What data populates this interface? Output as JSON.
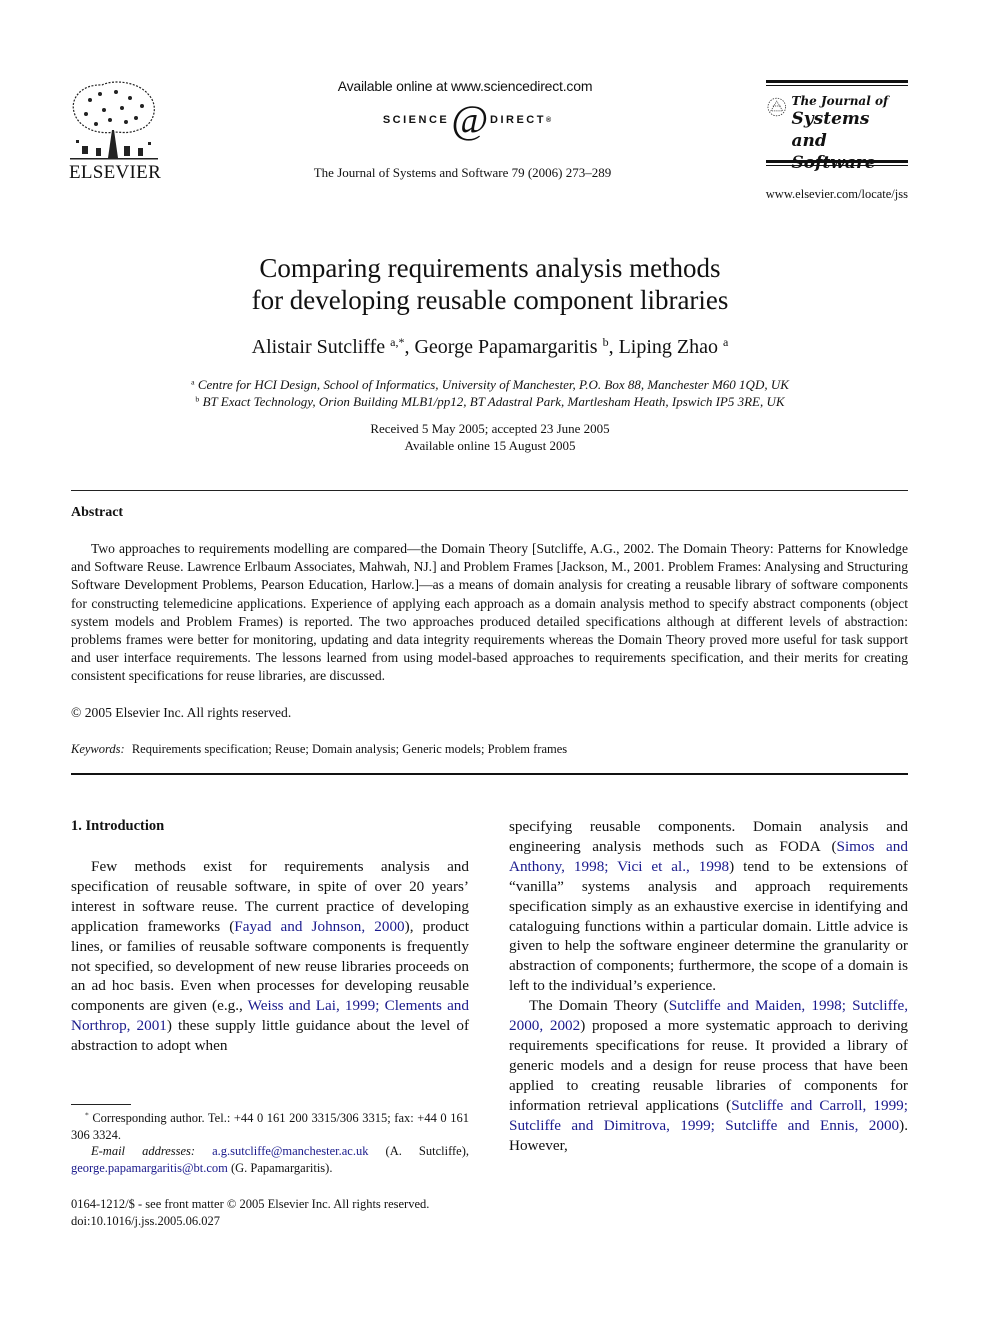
{
  "header": {
    "publisher_name": "ELSEVIER",
    "sciencedirect_available": "Available online at www.sciencedirect.com",
    "sciencedirect_left": "SCIENCE",
    "sciencedirect_at": "d",
    "sciencedirect_right": "DIRECT",
    "sciencedirect_reg": "®",
    "journal_citation": "The Journal of Systems and Software 79 (2006) 273–289",
    "journal_logo_line1": "The Journal of",
    "journal_logo_line2": "Systems and",
    "journal_logo_line3": "Software",
    "journal_url": "www.elsevier.com/locate/jss"
  },
  "paper": {
    "title_line1": "Comparing requirements analysis methods",
    "title_line2": "for developing reusable component libraries",
    "authors": [
      {
        "name": "Alistair Sutcliffe",
        "sup": "a,*"
      },
      {
        "name": "George Papamargaritis",
        "sup": "b"
      },
      {
        "name": "Liping Zhao",
        "sup": "a"
      }
    ],
    "affiliations": [
      {
        "mark": "a",
        "text": "Centre for HCI Design, School of Informatics, University of Manchester, P.O. Box 88, Manchester M60 1QD, UK"
      },
      {
        "mark": "b",
        "text": "BT Exact Technology, Orion Building MLB1/pp12, BT Adastral Park, Martlesham Heath, Ipswich IP5 3RE, UK"
      }
    ],
    "received": "Received 5 May 2005; accepted 23 June 2005",
    "available_online": "Available online 15 August 2005"
  },
  "abstract": {
    "heading": "Abstract",
    "body": "Two approaches to requirements modelling are compared—the Domain Theory [Sutcliffe, A.G., 2002. The Domain Theory: Patterns for Knowledge and Software Reuse. Lawrence Erlbaum Associates, Mahwah, NJ.] and Problem Frames [Jackson, M., 2001. Problem Frames: Analysing and Structuring Software Development Problems, Pearson Education, Harlow.]—as a means of domain analysis for creating a reusable library of software components for constructing telemedicine applications. Experience of applying each approach as a domain analysis method to specify abstract components (object system models and Problem Frames) is reported. The two approaches produced detailed specifications although at different levels of abstraction: problems frames were better for monitoring, updating and data integrity requirements whereas the Domain Theory proved more useful for task support and user interface requirements. The lessons learned from using model-based approaches to requirements specification, and their merits for creating consistent specifications for reuse libraries, are discussed.",
    "copyright": "© 2005 Elsevier Inc. All rights reserved.",
    "keywords_label": "Keywords:",
    "keywords": "Requirements specification; Reuse; Domain analysis; Generic models; Problem frames"
  },
  "introduction": {
    "heading": "1. Introduction",
    "left_p1": [
      {
        "t": "Few methods exist for requirements analysis and specification of reusable software, in spite of over 20 years’ interest in software reuse. The current practice of developing application frameworks ("
      },
      {
        "t": "Fayad and Johnson, 2000",
        "link": true
      },
      {
        "t": "), product lines, or families of reusable software components is frequently not specified, so development of new reuse libraries proceeds on an ad hoc basis. Even when processes for developing reusable components are given (e.g., "
      },
      {
        "t": "Weiss and Lai, 1999; Clements and Northrop, 2001",
        "link": true
      },
      {
        "t": ") these supply little guidance about the level of abstraction to adopt when"
      }
    ],
    "right_p1": [
      {
        "t": "specifying reusable components. Domain analysis and engineering analysis methods such as FODA ("
      },
      {
        "t": "Simos and Anthony, 1998; Vici et al., 1998",
        "link": true
      },
      {
        "t": ") tend to be extensions of “vanilla” systems analysis and approach requirements specification simply as an exhaustive exercise in identifying and cataloguing functions within a particular domain. Little advice is given to help the software engineer determine the granularity or abstraction of components; furthermore, the scope of a domain is left to the individual’s experience."
      }
    ],
    "right_p2": [
      {
        "t": "The Domain Theory ("
      },
      {
        "t": "Sutcliffe and Maiden, 1998; Sutcliffe, 2000, 2002",
        "link": true
      },
      {
        "t": ") proposed a more systematic approach to deriving requirements specifications for reuse. It provided a library of generic models and a design for reuse process that have been applied to creating reusable libraries of components for information retrieval applications ("
      },
      {
        "t": "Sutcliffe and Carroll, 1999; Sutcliffe and Dimitrova, 1999; Sutcliffe and Ennis, 2000",
        "link": true
      },
      {
        "t": "). However,"
      }
    ]
  },
  "footnotes": {
    "corresponding_mark": "*",
    "corresponding": "Corresponding author. Tel.: +44 0 161 200 3315/306 3315; fax: +44 0 161 306 3324.",
    "email_label": "E-mail addresses:",
    "email1": "a.g.sutcliffe@manchester.ac.uk",
    "email1_owner": "(A. Sutcliffe),",
    "email2": "george.papamargaritis@bt.com",
    "email2_owner": "(G. Papamargaritis)."
  },
  "footer": {
    "issn": "0164-1212/$ - see front matter © 2005 Elsevier Inc. All rights reserved.",
    "doi": "doi:10.1016/j.jss.2005.06.027"
  },
  "colors": {
    "link": "#1a1a8c",
    "text": "#111111"
  }
}
